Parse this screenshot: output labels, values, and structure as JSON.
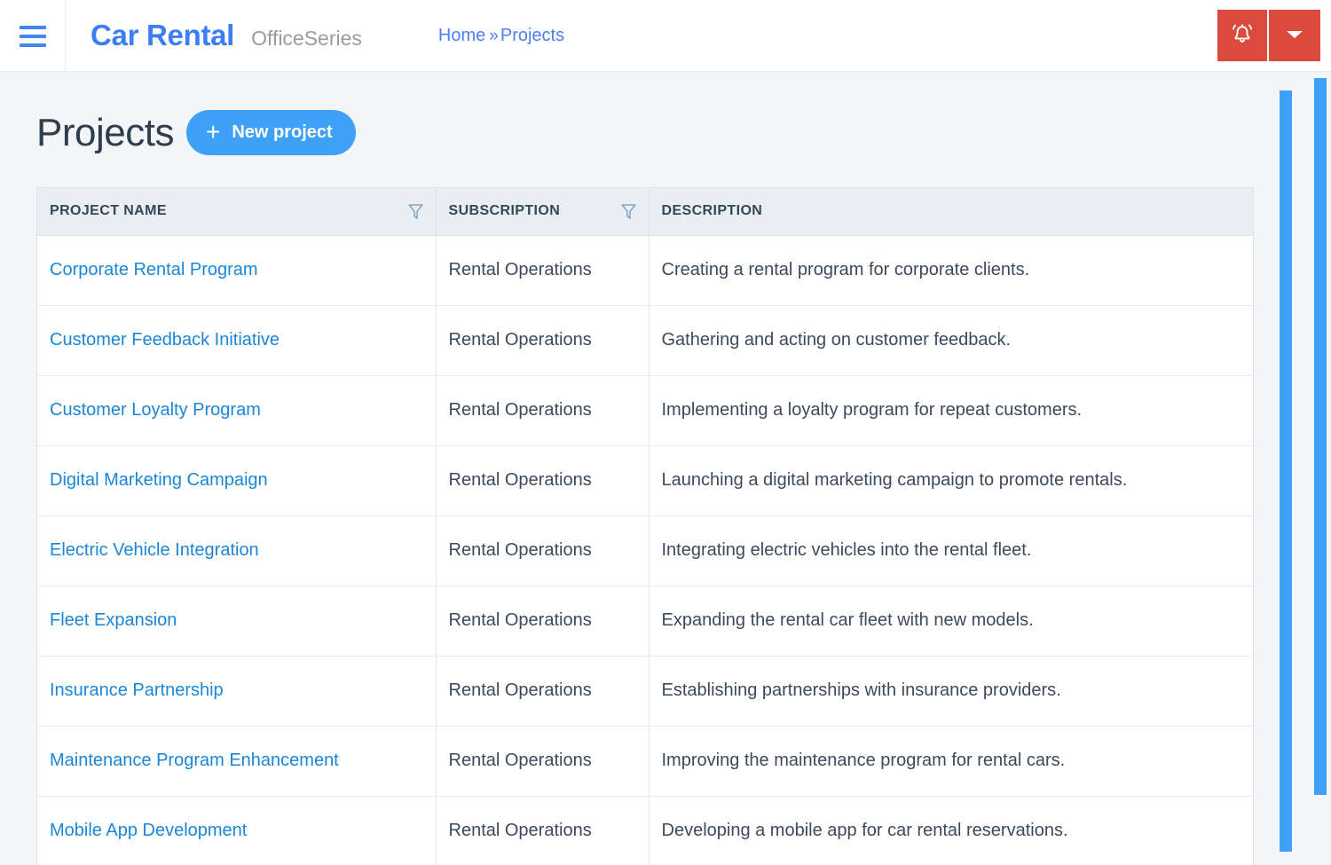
{
  "header": {
    "menu_icon": "hamburger-icon",
    "brand": "Car Rental",
    "brand_suffix": "OfficeSeries",
    "breadcrumb": {
      "home": "Home",
      "separator": "»",
      "current": "Projects"
    },
    "notification_icon": "bell-ringing-icon",
    "dropdown_icon": "caret-down-icon",
    "accent_red": "#dc4a3d",
    "accent_blue": "#3b7ff5"
  },
  "page": {
    "title": "Projects",
    "new_project_label": "New project",
    "new_project_icon": "plus-icon",
    "accent_button": "#3fa0f7"
  },
  "table": {
    "columns": [
      {
        "label": "PROJECT NAME",
        "filter_icon": "filter-funnel-icon",
        "filterable": true
      },
      {
        "label": "SUBSCRIPTION",
        "filter_icon": "filter-funnel-icon",
        "filterable": true
      },
      {
        "label": "DESCRIPTION",
        "filter_icon": "",
        "filterable": false
      }
    ],
    "rows": [
      {
        "name": "Corporate Rental Program",
        "subscription": "Rental Operations",
        "description": "Creating a rental program for corporate clients."
      },
      {
        "name": "Customer Feedback Initiative",
        "subscription": "Rental Operations",
        "description": "Gathering and acting on customer feedback."
      },
      {
        "name": "Customer Loyalty Program",
        "subscription": "Rental Operations",
        "description": "Implementing a loyalty program for repeat customers."
      },
      {
        "name": "Digital Marketing Campaign",
        "subscription": "Rental Operations",
        "description": "Launching a digital marketing campaign to promote rentals."
      },
      {
        "name": "Electric Vehicle Integration",
        "subscription": "Rental Operations",
        "description": "Integrating electric vehicles into the rental fleet."
      },
      {
        "name": "Fleet Expansion",
        "subscription": "Rental Operations",
        "description": "Expanding the rental car fleet with new models."
      },
      {
        "name": "Insurance Partnership",
        "subscription": "Rental Operations",
        "description": "Establishing partnerships with insurance providers."
      },
      {
        "name": "Maintenance Program Enhancement",
        "subscription": "Rental Operations",
        "description": "Improving the maintenance program for rental cars."
      },
      {
        "name": "Mobile App Development",
        "subscription": "Rental Operations",
        "description": "Developing a mobile app for car rental reservations."
      }
    ]
  },
  "scrollbars": {
    "inner_color": "#3fa0f7",
    "outer_color": "#3fa0f7"
  }
}
